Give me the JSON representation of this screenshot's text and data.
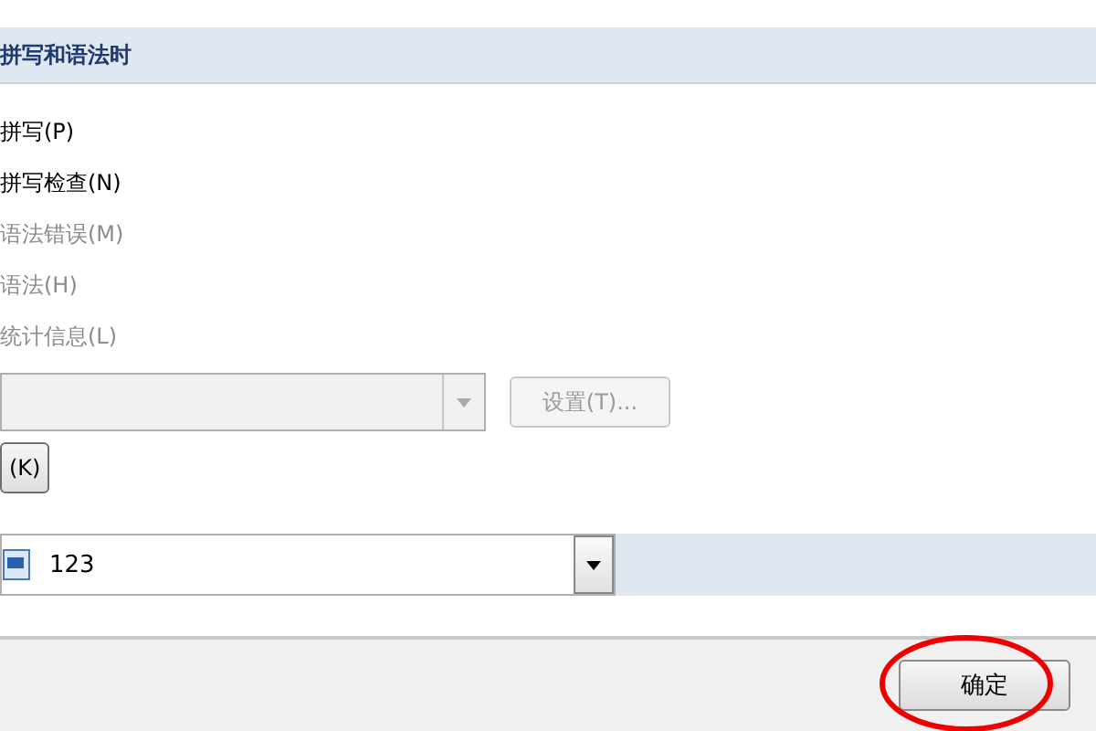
{
  "section": {
    "title": "拼写和语法时"
  },
  "options": [
    {
      "label": "拼写(P)",
      "disabled": false
    },
    {
      "label": "拼写检查(N)",
      "disabled": false
    },
    {
      "label": "语法错误(M)",
      "disabled": true
    },
    {
      "label": "语法(H)",
      "disabled": true
    },
    {
      "label": "统计信息(L)",
      "disabled": true
    }
  ],
  "style_select": {
    "disabled": true
  },
  "settings_button": {
    "label": "设置(T)...",
    "disabled": true
  },
  "recheck_button": {
    "label": "(K)"
  },
  "document_select": {
    "value": "123"
  },
  "footer": {
    "ok_button": "确定"
  }
}
